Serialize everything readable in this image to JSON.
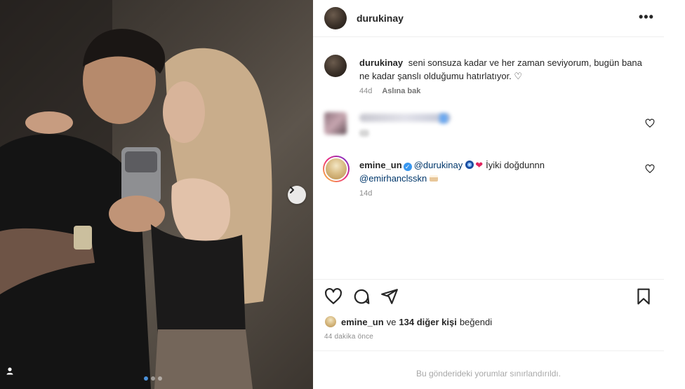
{
  "post": {
    "author": "durukinay",
    "more_icon": "more-horizontal-icon",
    "carousel": {
      "dots": 3,
      "active_dot": 1
    }
  },
  "caption": {
    "username": "durukinay",
    "text": "seni sonsuza kadar ve her zaman seviyorum, bugün bana ne kadar şanslı olduğumu hatırlatıyor. ♡",
    "time": "44d",
    "see_translation": "Aslına bak"
  },
  "comments": [
    {
      "username": "emine_un",
      "verified": true,
      "mention1": "@durukinay",
      "text": "İyiki doğdunnn",
      "mention2": "@emirhanclsskn",
      "time": "14d"
    }
  ],
  "actions": {
    "like_icon": "heart-icon",
    "comment_icon": "comment-icon",
    "share_icon": "share-icon",
    "save_icon": "bookmark-icon"
  },
  "likes": {
    "first_user": "emine_un",
    "connector": "ve",
    "others": "134 diğer kişi",
    "suffix": "beğendi"
  },
  "time_ago": "44 dakika önce",
  "comments_restricted": "Bu gönderideki yorumlar sınırlandırıldı.",
  "colors": {
    "verified": "#3897f0",
    "mention": "#00376b",
    "muted": "#8e8e8e",
    "story_ring": [
      "#f9ce34",
      "#ee2a7b",
      "#6228d7"
    ]
  }
}
